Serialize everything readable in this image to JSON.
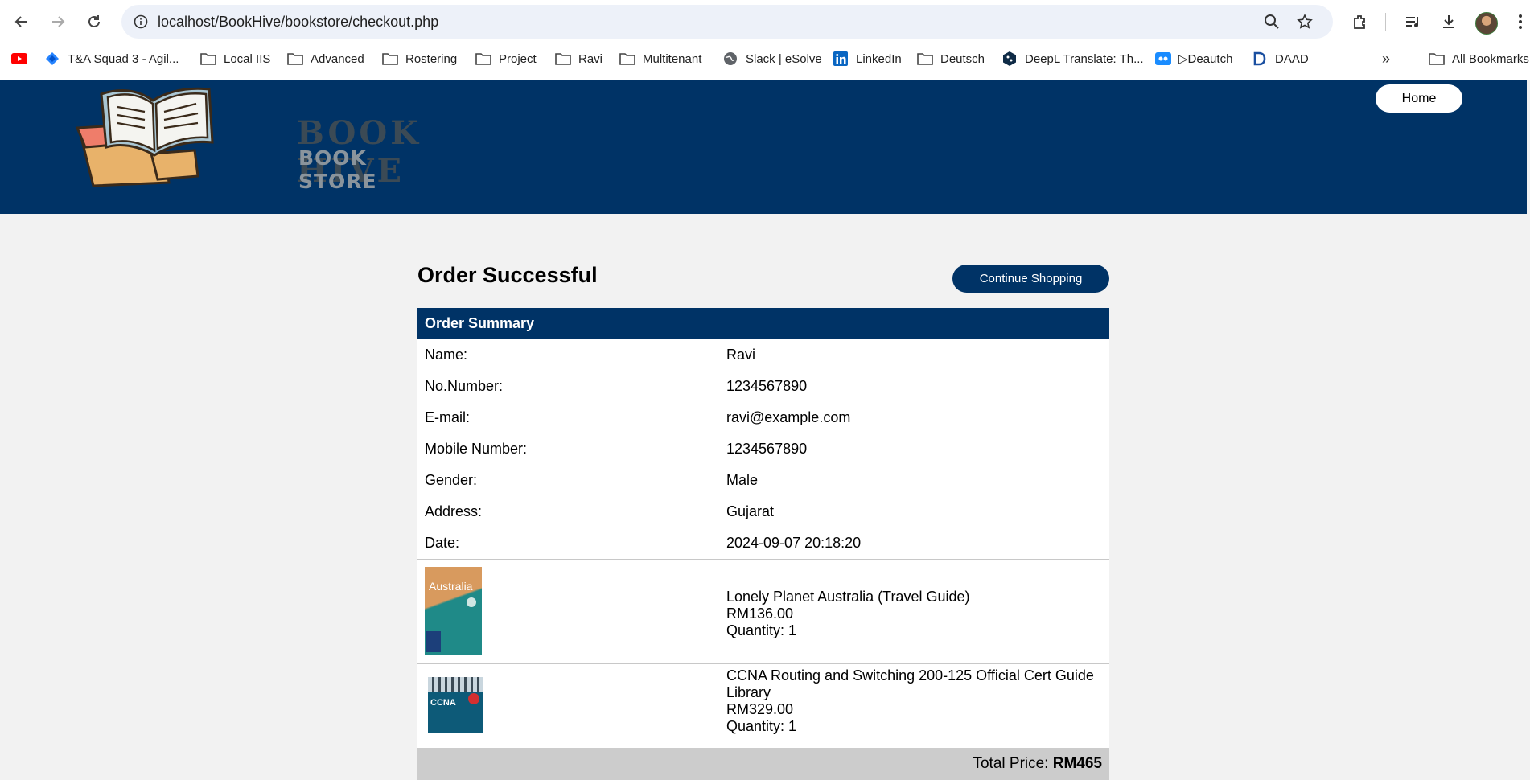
{
  "browser": {
    "url": "localhost/BookHive/bookstore/checkout.php",
    "bookmarks": [
      {
        "label": "T&A Squad 3 - Agil...",
        "icon": "jira-icon"
      },
      {
        "label": "Local IIS",
        "icon": "folder-icon"
      },
      {
        "label": "Advanced",
        "icon": "folder-icon"
      },
      {
        "label": "Rostering",
        "icon": "folder-icon"
      },
      {
        "label": "Project",
        "icon": "folder-icon"
      },
      {
        "label": "Ravi",
        "icon": "folder-icon"
      },
      {
        "label": "Multitenant",
        "icon": "folder-icon"
      },
      {
        "label": "Slack | eSolve",
        "icon": "globe-icon"
      },
      {
        "label": "LinkedIn",
        "icon": "linkedin-icon"
      },
      {
        "label": "Deutsch",
        "icon": "folder-icon"
      },
      {
        "label": "DeepL Translate: Th...",
        "icon": "deepl-icon"
      },
      {
        "label": "▷Deautch",
        "icon": "video-icon"
      },
      {
        "label": "DAAD",
        "icon": "daad-icon"
      }
    ],
    "all_bookmarks": "All Bookmarks"
  },
  "header": {
    "logo_title": "BOOK HIVE",
    "logo_subtitle": "BOOK STORE",
    "home_label": "Home"
  },
  "page": {
    "title": "Order Successful",
    "continue_label": "Continue Shopping"
  },
  "summary": {
    "heading": "Order Summary",
    "fields": [
      {
        "label": "Name:",
        "value": "Ravi"
      },
      {
        "label": "No.Number:",
        "value": "1234567890"
      },
      {
        "label": "E-mail:",
        "value": "ravi@example.com"
      },
      {
        "label": "Mobile Number:",
        "value": "1234567890"
      },
      {
        "label": "Gender:",
        "value": "Male"
      },
      {
        "label": "Address:",
        "value": "Gujarat"
      },
      {
        "label": "Date:",
        "value": "2024-09-07 20:18:20"
      }
    ],
    "items": [
      {
        "title": "Lonely Planet Australia (Travel Guide)",
        "price": "RM136.00",
        "quantity": "Quantity: 1",
        "cover_text": "Australia"
      },
      {
        "title": "CCNA Routing and Switching 200-125 Official Cert Guide Library",
        "price": "RM329.00",
        "quantity": "Quantity: 1",
        "cover_text": "CCNA"
      }
    ],
    "total_label": "Total Price:",
    "total_value": "RM465"
  },
  "colors": {
    "brand": "#003366",
    "page_bg": "#f2f2f2",
    "total_bg": "#cccccc"
  }
}
